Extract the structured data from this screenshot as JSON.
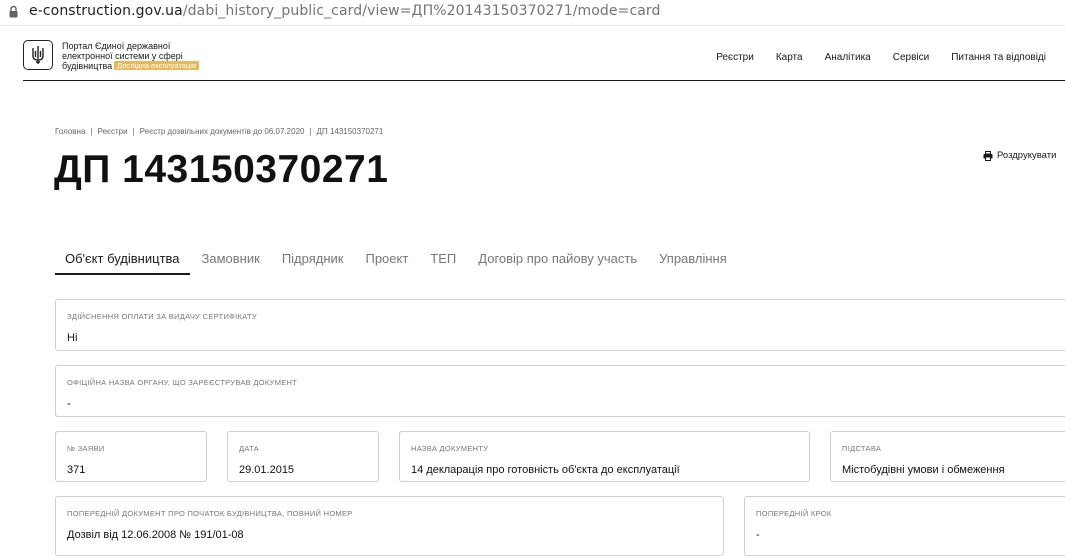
{
  "browser": {
    "url_host": "e-construction.gov.ua",
    "url_path": "/dabi_history_public_card/view=ДП%20143150370271/mode=card"
  },
  "header": {
    "portal_line1": "Портал Єдиної державної",
    "portal_line2": "електронної системи у сфері",
    "portal_line3": "будівництва",
    "badge": "Дослідна експлуатація",
    "badge_color": "#e6b95a",
    "nav": [
      "Реєстри",
      "Карта",
      "Аналітика",
      "Сервіси",
      "Питання та відповіді"
    ]
  },
  "breadcrumb": [
    "Головна",
    "Реєстри",
    "Реєстр дозвільних документів до 06.07.2020",
    "ДП 143150370271"
  ],
  "title": "ДП 143150370271",
  "print_label": "Роздрукувати",
  "tabs": [
    "Об'єкт будівництва",
    "Замовник",
    "Підрядник",
    "Проект",
    "ТЕП",
    "Договір про пайову участь",
    "Управління"
  ],
  "active_tab": "Об'єкт будівництва",
  "fields": {
    "payment": {
      "label": "Здійснення оплати за видачу сертифікату",
      "value": "Ні"
    },
    "organ": {
      "label": "Офіційна назва органу, що зареєстрував документ",
      "value": "-"
    },
    "app_no": {
      "label": "№ заяви",
      "value": "371"
    },
    "date": {
      "label": "Дата",
      "value": "29.01.2015"
    },
    "doc_name": {
      "label": "Назва документу",
      "value": "14 декларація про готовність об'єкта до експлуатації"
    },
    "basis": {
      "label": "Підстава",
      "value": "Містобудівні умови і обмеження"
    },
    "prev_doc": {
      "label": "Попередній документ про початок будівництва, повний номер",
      "value": "Дозвіл від 12.06.2008 № 191/01-08"
    },
    "prev_step": {
      "label": "Попередній крок",
      "value": "-"
    }
  }
}
